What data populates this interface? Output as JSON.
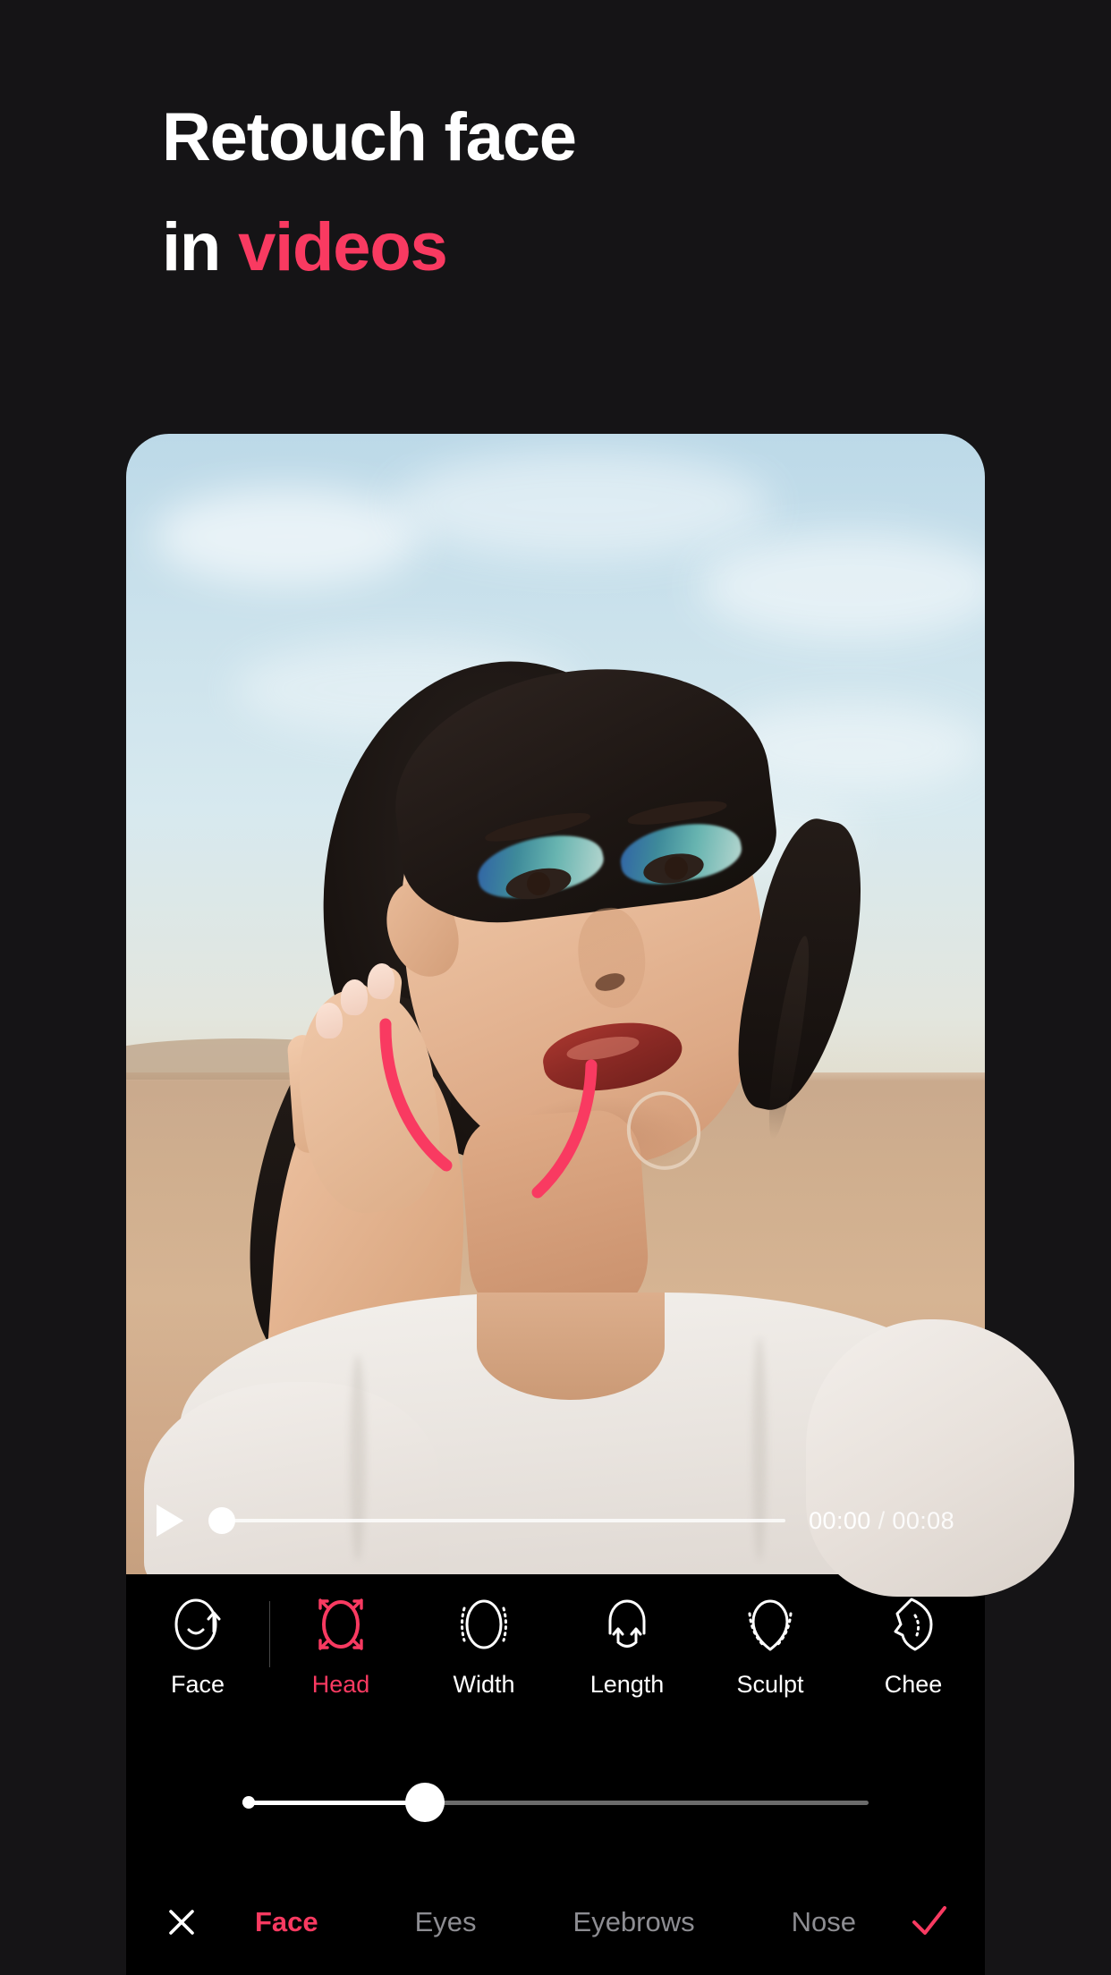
{
  "theme": {
    "page_background": "#151416",
    "panel_background": "#000000",
    "accent_pink": "#F93A61",
    "text_white": "#FFFFFF",
    "text_muted": "#8D8D92"
  },
  "headline": {
    "line1": "Retouch face",
    "line2_prefix": "in ",
    "line2_accent": "videos"
  },
  "player": {
    "play_icon": "play-triangle-icon",
    "current_time": "00:00",
    "separator": "/",
    "total_time": "00:08",
    "progress_percent": 0
  },
  "overlay": {
    "guide_color": "#F93A61",
    "guide_name": "face-shape-guide-arcs"
  },
  "tools": {
    "items": [
      {
        "label": "Face",
        "icon": "face-smile-oval-icon",
        "active": false
      },
      {
        "label": "Head",
        "icon": "head-resize-corners-icon",
        "active": true
      },
      {
        "label": "Width",
        "icon": "oval-width-dots-icon",
        "active": false
      },
      {
        "label": "Length",
        "icon": "arch-up-arrows-icon",
        "active": false
      },
      {
        "label": "Sculpt",
        "icon": "oval-sculpt-dots-icon",
        "active": false
      },
      {
        "label": "Chee",
        "icon": "cheekbones-profile-icon",
        "active": false
      }
    ]
  },
  "intensity_slider": {
    "name": "intensity-slider",
    "value_percent": 28,
    "fill_color": "#FFFFFF",
    "track_color": "#6B6B6B"
  },
  "bottom_bar": {
    "close_icon": "close-x-icon",
    "confirm_icon": "check-icon",
    "tabs": [
      {
        "label": "Face",
        "active": true
      },
      {
        "label": "Eyes",
        "active": false
      },
      {
        "label": "Eyebrows",
        "active": false
      },
      {
        "label": "Nose",
        "active": false
      }
    ]
  }
}
